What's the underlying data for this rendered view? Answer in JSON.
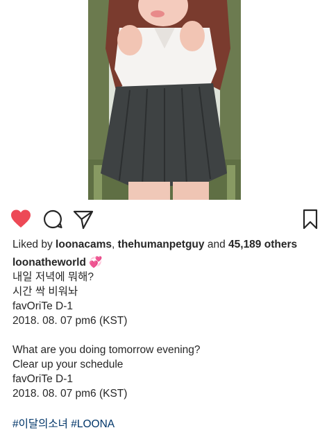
{
  "post": {
    "liked_by_prefix": "Liked by ",
    "liker1": "loonacams",
    "sep": ", ",
    "liker2": "thehumanpetguy",
    "and_text": " and ",
    "likes_count": "45,189 others",
    "author": "loonatheworld",
    "author_emoji": "💞",
    "caption_lines_ko": [
      "내일 저녁에 뭐해?",
      "시간 싹 비워놔",
      "favOriTe D-1",
      "2018. 08. 07 pm6 (KST)"
    ],
    "caption_lines_en": [
      "What are you doing tomorrow evening?",
      "Clear up your schedule",
      "favOriTe D-1",
      "2018. 08. 07 pm6 (KST)"
    ],
    "hashtags": [
      "#이달의소녀",
      "#LOONA"
    ]
  },
  "icons": {
    "like": "heart-filled-icon",
    "comment": "comment-bubble-icon",
    "share": "paper-plane-icon",
    "save": "bookmark-icon"
  },
  "colors": {
    "like_red": "#ed4956",
    "text": "#262626",
    "hashtag": "#003569"
  }
}
